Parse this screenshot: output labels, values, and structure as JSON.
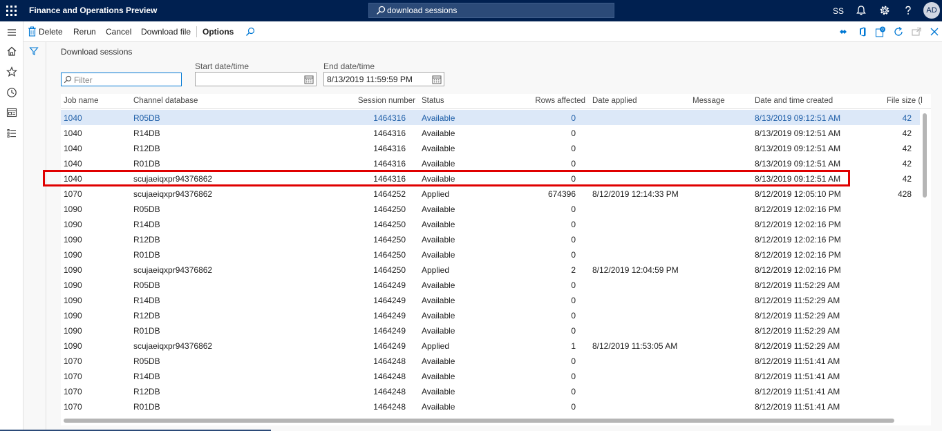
{
  "app": {
    "title": "Finance and Operations Preview"
  },
  "search": {
    "value": "download sessions"
  },
  "topbar": {
    "user_initials_short": "SS",
    "avatar_initials": "AD"
  },
  "actions": {
    "delete": "Delete",
    "rerun": "Rerun",
    "cancel": "Cancel",
    "download_file": "Download file",
    "options": "Options"
  },
  "page": {
    "title": "Download sessions",
    "filter_placeholder": "Filter",
    "start_date_label": "Start date/time",
    "start_date_value": "",
    "end_date_label": "End date/time",
    "end_date_value": "8/13/2019 11:59:59 PM"
  },
  "grid": {
    "columns": {
      "job_name": "Job name",
      "channel_database": "Channel database",
      "session_number": "Session number",
      "status": "Status",
      "rows_affected": "Rows affected",
      "date_applied": "Date applied",
      "message": "Message",
      "date_created": "Date and time created",
      "file_size": "File size (l"
    },
    "rows": [
      {
        "job": "1040",
        "db": "R05DB",
        "session": "1464316",
        "status": "Available",
        "rows": "0",
        "applied": "",
        "created": "8/13/2019 09:12:51 AM",
        "size": "42"
      },
      {
        "job": "1040",
        "db": "R14DB",
        "session": "1464316",
        "status": "Available",
        "rows": "0",
        "applied": "",
        "created": "8/13/2019 09:12:51 AM",
        "size": "42"
      },
      {
        "job": "1040",
        "db": "R12DB",
        "session": "1464316",
        "status": "Available",
        "rows": "0",
        "applied": "",
        "created": "8/13/2019 09:12:51 AM",
        "size": "42"
      },
      {
        "job": "1040",
        "db": "R01DB",
        "session": "1464316",
        "status": "Available",
        "rows": "0",
        "applied": "",
        "created": "8/13/2019 09:12:51 AM",
        "size": "42"
      },
      {
        "job": "1040",
        "db": "scujaeiqxpr94376862",
        "session": "1464316",
        "status": "Available",
        "rows": "0",
        "applied": "",
        "created": "8/13/2019 09:12:51 AM",
        "size": "42"
      },
      {
        "job": "1070",
        "db": "scujaeiqxpr94376862",
        "session": "1464252",
        "status": "Applied",
        "rows": "674396",
        "applied": "8/12/2019 12:14:33 PM",
        "created": "8/12/2019 12:05:10 PM",
        "size": "428"
      },
      {
        "job": "1090",
        "db": "R05DB",
        "session": "1464250",
        "status": "Available",
        "rows": "0",
        "applied": "",
        "created": "8/12/2019 12:02:16 PM",
        "size": ""
      },
      {
        "job": "1090",
        "db": "R14DB",
        "session": "1464250",
        "status": "Available",
        "rows": "0",
        "applied": "",
        "created": "8/12/2019 12:02:16 PM",
        "size": ""
      },
      {
        "job": "1090",
        "db": "R12DB",
        "session": "1464250",
        "status": "Available",
        "rows": "0",
        "applied": "",
        "created": "8/12/2019 12:02:16 PM",
        "size": ""
      },
      {
        "job": "1090",
        "db": "R01DB",
        "session": "1464250",
        "status": "Available",
        "rows": "0",
        "applied": "",
        "created": "8/12/2019 12:02:16 PM",
        "size": ""
      },
      {
        "job": "1090",
        "db": "scujaeiqxpr94376862",
        "session": "1464250",
        "status": "Applied",
        "rows": "2",
        "applied": "8/12/2019 12:04:59 PM",
        "created": "8/12/2019 12:02:16 PM",
        "size": ""
      },
      {
        "job": "1090",
        "db": "R05DB",
        "session": "1464249",
        "status": "Available",
        "rows": "0",
        "applied": "",
        "created": "8/12/2019 11:52:29 AM",
        "size": ""
      },
      {
        "job": "1090",
        "db": "R14DB",
        "session": "1464249",
        "status": "Available",
        "rows": "0",
        "applied": "",
        "created": "8/12/2019 11:52:29 AM",
        "size": ""
      },
      {
        "job": "1090",
        "db": "R12DB",
        "session": "1464249",
        "status": "Available",
        "rows": "0",
        "applied": "",
        "created": "8/12/2019 11:52:29 AM",
        "size": ""
      },
      {
        "job": "1090",
        "db": "R01DB",
        "session": "1464249",
        "status": "Available",
        "rows": "0",
        "applied": "",
        "created": "8/12/2019 11:52:29 AM",
        "size": ""
      },
      {
        "job": "1090",
        "db": "scujaeiqxpr94376862",
        "session": "1464249",
        "status": "Applied",
        "rows": "1",
        "applied": "8/12/2019 11:53:05 AM",
        "created": "8/12/2019 11:52:29 AM",
        "size": ""
      },
      {
        "job": "1070",
        "db": "R05DB",
        "session": "1464248",
        "status": "Available",
        "rows": "0",
        "applied": "",
        "created": "8/12/2019 11:51:41 AM",
        "size": ""
      },
      {
        "job": "1070",
        "db": "R14DB",
        "session": "1464248",
        "status": "Available",
        "rows": "0",
        "applied": "",
        "created": "8/12/2019 11:51:41 AM",
        "size": ""
      },
      {
        "job": "1070",
        "db": "R12DB",
        "session": "1464248",
        "status": "Available",
        "rows": "0",
        "applied": "",
        "created": "8/12/2019 11:51:41 AM",
        "size": ""
      },
      {
        "job": "1070",
        "db": "R01DB",
        "session": "1464248",
        "status": "Available",
        "rows": "0",
        "applied": "",
        "created": "8/12/2019 11:51:41 AM",
        "size": ""
      }
    ]
  },
  "colors": {
    "nav_bar": "#002050",
    "accent": "#0078d4",
    "highlight": "#e00000",
    "selected_row": "#dce8f8"
  },
  "icons": {
    "waffle": "app-launcher-icon",
    "search": "search-icon",
    "bell": "notification-bell-icon",
    "gear": "settings-gear-icon",
    "help": "help-icon",
    "trash": "delete-icon",
    "filter": "filter-icon",
    "calendar": "calendar-icon"
  }
}
